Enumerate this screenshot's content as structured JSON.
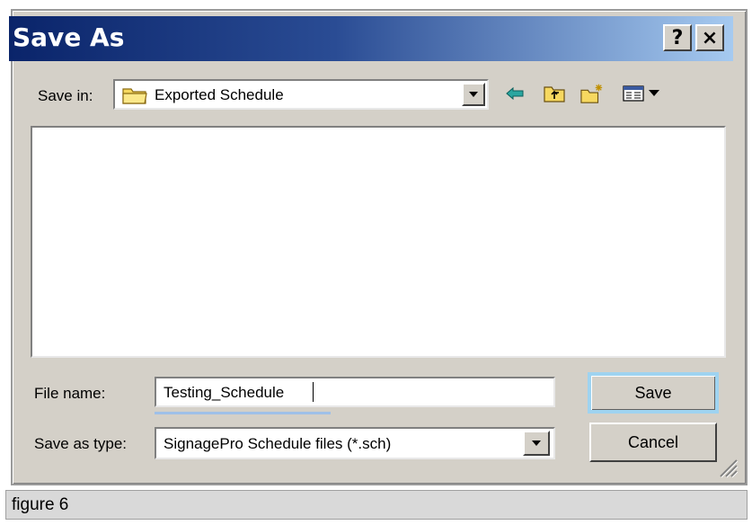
{
  "dialog": {
    "title": "Save As",
    "help_button": "?",
    "close_button": "×"
  },
  "save_in": {
    "label": "Save in:",
    "value": "Exported Schedule",
    "icon": "folder-icon"
  },
  "toolbar": {
    "icons": [
      "back-arrow-icon",
      "up-folder-icon",
      "new-folder-icon",
      "view-menu-icon"
    ]
  },
  "file_name": {
    "label": "File name:",
    "value": "Testing_Schedule"
  },
  "save_as_type": {
    "label": "Save as type:",
    "value": "SignagePro Schedule files (*.sch)"
  },
  "buttons": {
    "save": "Save",
    "cancel": "Cancel"
  },
  "caption": "figure 6",
  "colors": {
    "titlebar_start": "#0a246a",
    "titlebar_end": "#a6caf0",
    "face": "#d4d0c8",
    "default_focus": "#9fd3f0"
  }
}
